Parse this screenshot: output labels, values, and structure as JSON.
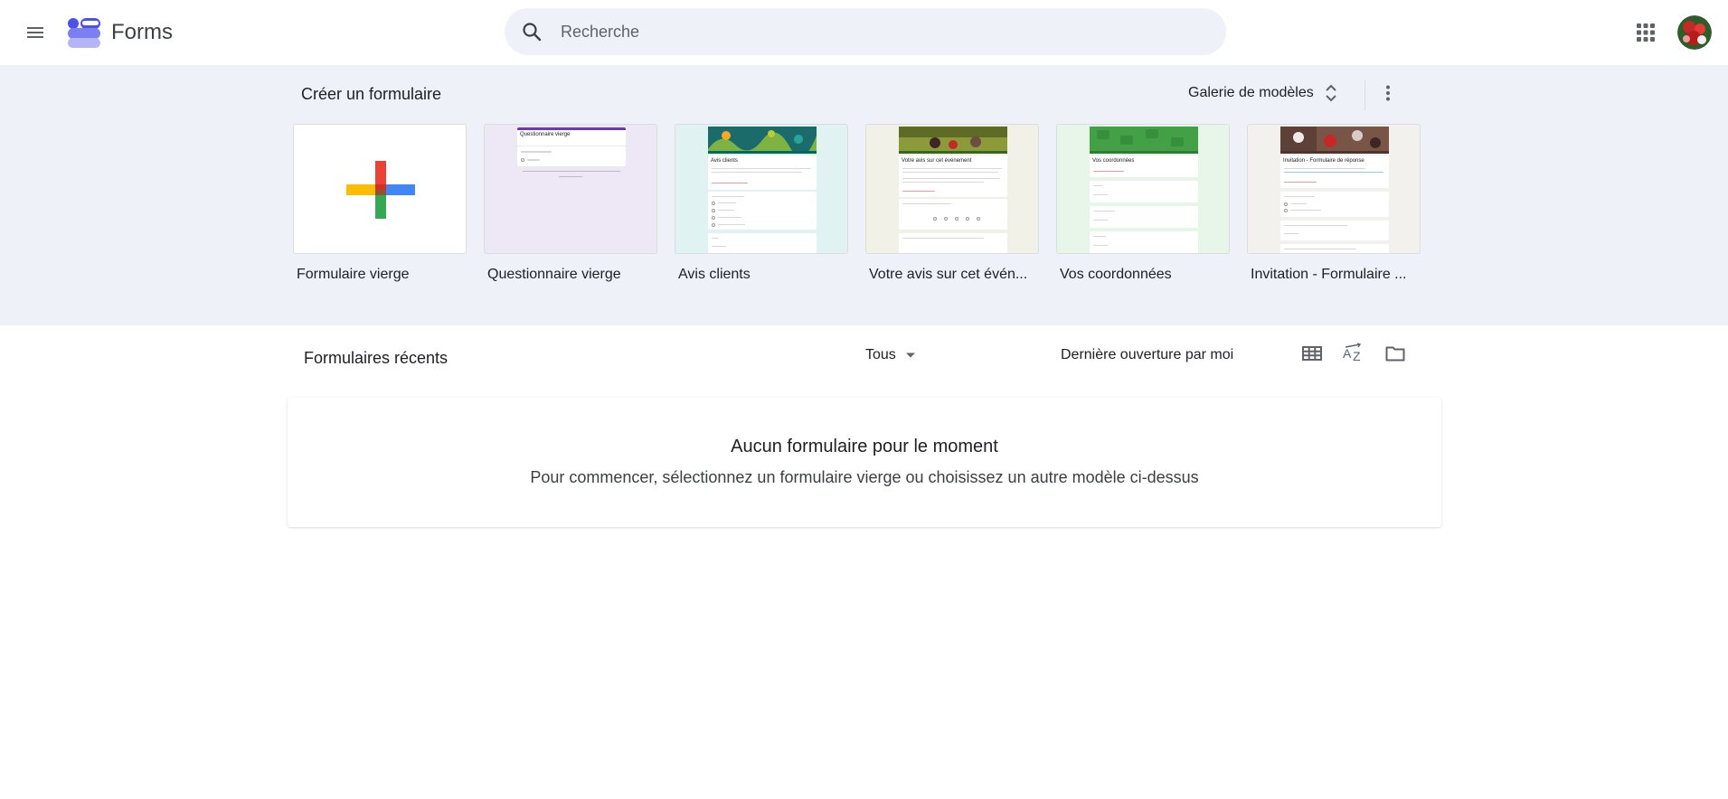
{
  "header": {
    "app_name": "Forms",
    "search_placeholder": "Recherche",
    "menu_icon": "hamburger-menu-icon",
    "apps_icon": "google-apps-grid-icon"
  },
  "templates_section": {
    "title": "Créer un formulaire",
    "gallery_label": "Galerie de modèles",
    "templates": [
      {
        "label": "Formulaire vierge"
      },
      {
        "label": "Questionnaire vierge",
        "thumb_title": "Questionnaire vierge"
      },
      {
        "label": "Avis clients",
        "thumb_title": "Avis clients"
      },
      {
        "label": "Votre avis sur cet évén...",
        "thumb_title": "Votre avis sur cet événement"
      },
      {
        "label": "Vos coordonnées",
        "thumb_title": "Vos coordonnées"
      },
      {
        "label": "Invitation - Formulaire ...",
        "thumb_title": "Invitation - Formulaire de réponse"
      }
    ]
  },
  "recent_section": {
    "title": "Formulaires récents",
    "filter_label": "Tous",
    "sort_label": "Dernière ouverture par moi",
    "empty_title": "Aucun formulaire pour le moment",
    "empty_subtitle": "Pour commencer, sélectionnez un formulaire vierge ou choisissez un autre modèle ci-dessus"
  },
  "colors": {
    "band_background": "#eef2f8",
    "quiz_purple": "#673ab7",
    "teal": "#00796b",
    "green": "#43a047",
    "plus_red": "#ea4335",
    "plus_blue": "#4285f4",
    "plus_yellow": "#fbbc04",
    "plus_green": "#34a853"
  }
}
